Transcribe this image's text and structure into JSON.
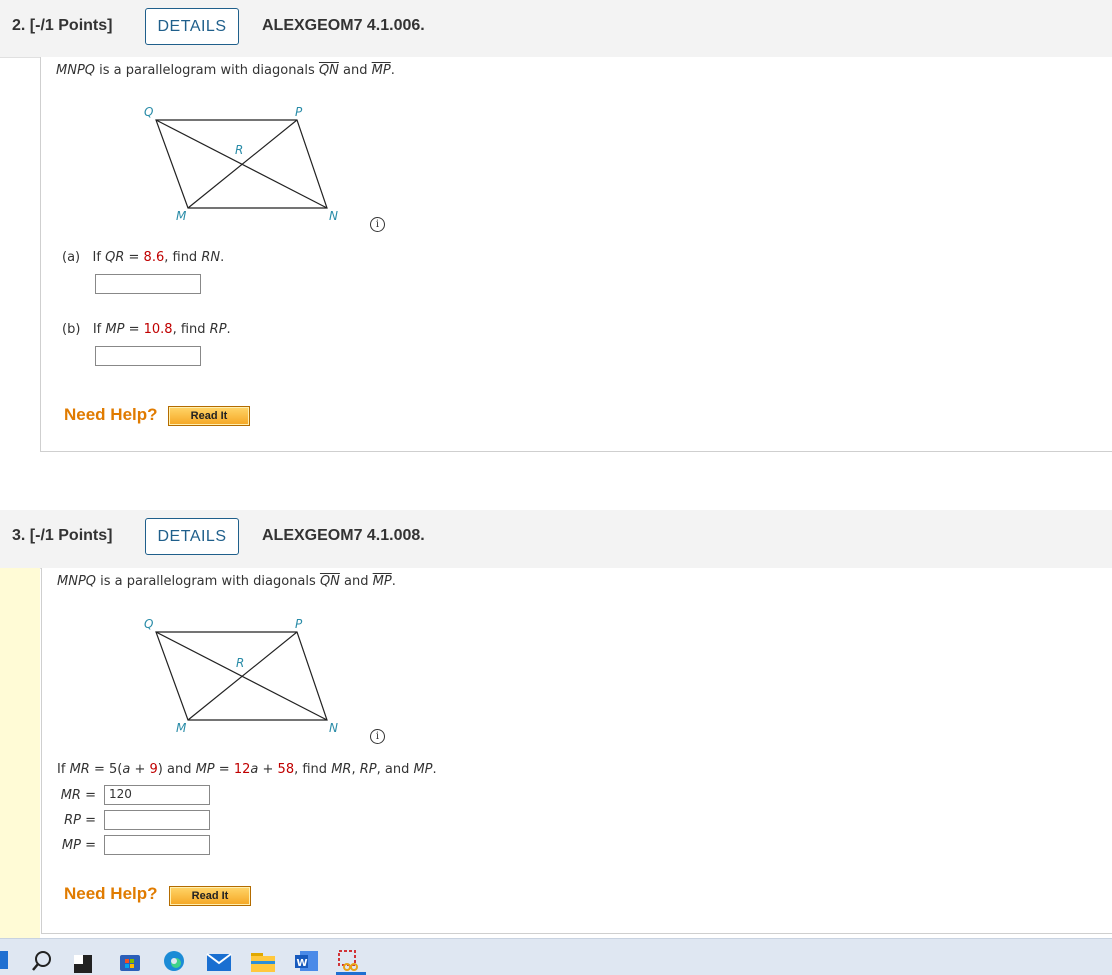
{
  "questions": [
    {
      "number": "2.",
      "points": "[-/1 Points]",
      "details_label": "DETAILS",
      "id": "ALEXGEOM7 4.1.006.",
      "prompt": {
        "shape": "MNPQ",
        "text1": "is a parallelogram with diagonals",
        "d1": "QN",
        "and": "and",
        "d2": "MP",
        "end": "."
      },
      "diagram_labels": {
        "Q": "Q",
        "P": "P",
        "R": "R",
        "M": "M",
        "N": "N"
      },
      "info_icon": "i",
      "parts": [
        {
          "label": "(a)",
          "if": "If",
          "var": "QR",
          "eq": "=",
          "value": "8.6",
          "find": ", find",
          "target": "RN",
          "end": ".",
          "answer": ""
        },
        {
          "label": "(b)",
          "if": "If",
          "var": "MP",
          "eq": "=",
          "value": "10.8",
          "find": ", find",
          "target": "RP",
          "end": ".",
          "answer": ""
        }
      ],
      "need_help": "Need Help?",
      "read_it": "Read It"
    },
    {
      "number": "3.",
      "points": "[-/1 Points]",
      "details_label": "DETAILS",
      "id": "ALEXGEOM7 4.1.008.",
      "prompt": {
        "shape": "MNPQ",
        "text1": "is a parallelogram with diagonals",
        "d1": "QN",
        "and": "and",
        "d2": "MP",
        "end": "."
      },
      "diagram_labels": {
        "Q": "Q",
        "P": "P",
        "R": "R",
        "M": "M",
        "N": "N"
      },
      "info_icon": "i",
      "equation": {
        "if": "If",
        "mr": "MR",
        "eq1": "= 5(",
        "a1": "a",
        "plus1": "+",
        "nine": "9",
        "close1": ")",
        "and": "and",
        "mp": "MP",
        "eq2": "=",
        "twelve": "12",
        "a2": "a",
        "plus2": "+",
        "fiftyeight": "58",
        "find": ", find",
        "t1": "MR",
        "c1": ",",
        "t2": "RP",
        "c2": ", and",
        "t3": "MP",
        "end": "."
      },
      "fields": [
        {
          "label": "MR",
          "eq": "=",
          "value": "120"
        },
        {
          "label": "RP",
          "eq": "=",
          "value": ""
        },
        {
          "label": "MP",
          "eq": "=",
          "value": ""
        }
      ],
      "need_help": "Need Help?",
      "read_it": "Read It"
    }
  ],
  "colors": {
    "accent": "#1f5f8b",
    "highlight": "#c00000",
    "help": "#e07b00",
    "label_blue": "#2a8ca8"
  },
  "taskbar": {
    "icons": [
      "windows-start-icon",
      "search-icon",
      "task-view-icon",
      "store-icon",
      "edge-icon",
      "mail-icon",
      "file-explorer-icon",
      "word-icon",
      "snipping-tool-icon"
    ]
  }
}
